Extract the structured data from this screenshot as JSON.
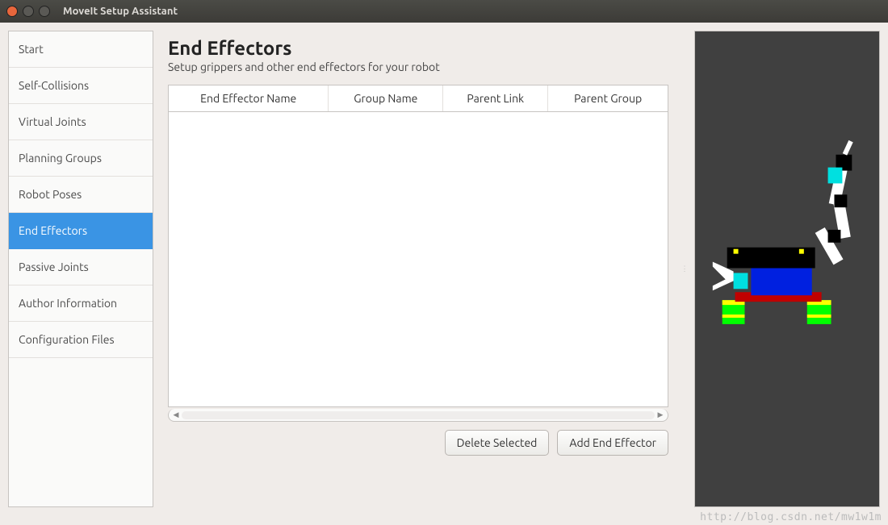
{
  "window": {
    "title": "MoveIt Setup Assistant"
  },
  "sidebar": {
    "items": [
      {
        "label": "Start"
      },
      {
        "label": "Self-Collisions"
      },
      {
        "label": "Virtual Joints"
      },
      {
        "label": "Planning Groups"
      },
      {
        "label": "Robot Poses"
      },
      {
        "label": "End Effectors",
        "selected": true
      },
      {
        "label": "Passive Joints"
      },
      {
        "label": "Author Information"
      },
      {
        "label": "Configuration Files"
      }
    ]
  },
  "main": {
    "title": "End Effectors",
    "subtitle": "Setup grippers and other end effectors for your robot",
    "columns": [
      "End Effector Name",
      "Group Name",
      "Parent Link",
      "Parent Group"
    ],
    "rows": [],
    "buttons": {
      "delete": "Delete Selected",
      "add": "Add End Effector"
    }
  },
  "watermark": "http://blog.csdn.net/mw1w1m",
  "preview": {
    "description": "3D rendering of a mobile robot with arm manipulator"
  }
}
